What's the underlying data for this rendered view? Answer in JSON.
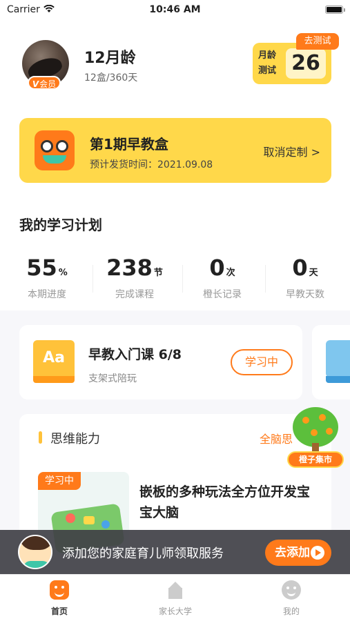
{
  "status_bar": {
    "carrier": "Carrier",
    "time": "10:46 AM"
  },
  "profile": {
    "age": "12月龄",
    "progress": "12盒/360天",
    "vip_v": "V",
    "vip_label": "会员"
  },
  "age_test": {
    "label": "月龄测试",
    "number": "26",
    "tag": "去测试"
  },
  "box_card": {
    "title": "第1期早教盒",
    "ship_date": "预计发货时间：2021.09.08",
    "cancel": "取消定制 >"
  },
  "plan": {
    "title": "我的学习计划",
    "stats": [
      {
        "value": "55",
        "unit": "%",
        "label": "本期进度"
      },
      {
        "value": "238",
        "unit": "节",
        "label": "完成课程"
      },
      {
        "value": "0",
        "unit": "次",
        "label": "橙长记录"
      },
      {
        "value": "0",
        "unit": "天",
        "label": "早教天数"
      }
    ]
  },
  "course": {
    "icon_text": "Aa",
    "title": "早教入门课 6/8",
    "subtitle": "支架式陪玩",
    "status": "学习中"
  },
  "thinking": {
    "title": "思维能力",
    "link": "全脑思",
    "lesson_tag": "学习中",
    "lesson_title": "嵌板的多种玩法全方位开发宝宝大脑"
  },
  "market": {
    "label": "橙子集市"
  },
  "banner": {
    "text": "添加您的家庭育儿师领取服务",
    "button": "去添加"
  },
  "tabs": [
    {
      "label": "首页",
      "icon": "home-face-icon",
      "active": true
    },
    {
      "label": "家长大学",
      "icon": "university-icon",
      "active": false
    },
    {
      "label": "我的",
      "icon": "profile-face-icon",
      "active": false
    }
  ],
  "colors": {
    "accent_orange": "#ff7a1a",
    "accent_yellow": "#ffd84a"
  }
}
